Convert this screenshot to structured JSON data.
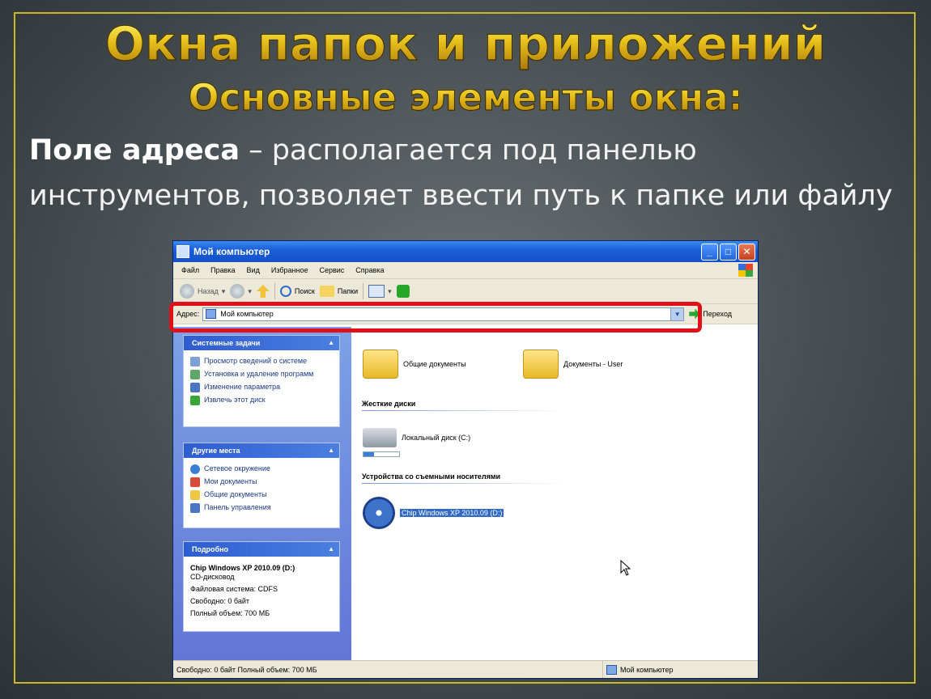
{
  "slide": {
    "title": "Окна папок и приложений",
    "subtitle": "Основные элементы окна:",
    "term": "Поле адреса",
    "dash": " – ",
    "line1_rest": "располагается под панелью",
    "line2": "инструментов, позволяет ввести путь к папке или файлу"
  },
  "window": {
    "title": "Мой компьютер",
    "menu": [
      "Файл",
      "Правка",
      "Вид",
      "Избранное",
      "Сервис",
      "Справка"
    ],
    "toolbar": {
      "back": "Назад",
      "search": "Поиск",
      "folders": "Папки"
    },
    "address": {
      "label": "Адрес:",
      "value": "Мой компьютер",
      "go": "Переход"
    },
    "system_tasks": {
      "title": "Системные задачи",
      "items": [
        "Просмотр сведений о системе",
        "Установка и удаление программ",
        "Изменение параметра",
        "Извлечь этот диск"
      ]
    },
    "other_places": {
      "title": "Другие места",
      "items": [
        "Сетевое окружение",
        "Мои документы",
        "Общие документы",
        "Панель управления"
      ]
    },
    "details": {
      "title": "Подробно",
      "name": "Chip Windows XP 2010.09 (D:)",
      "type": "CD-дисковод",
      "fs": "Файловая система: CDFS",
      "free": "Свободно: 0 байт",
      "total": "Полный объем: 700 МБ"
    },
    "content": {
      "folders": [
        "Общие документы",
        "Документы - User"
      ],
      "hard_disks_title": "Жесткие диски",
      "local_disk": "Локальный диск (C:)",
      "removable_title": "Устройства со съемными носителями",
      "cd_drive": "Chip Windows XP 2010.09 (D:)"
    },
    "status": {
      "left": "Свободно: 0 байт Полный объем: 700 МБ",
      "right": "Мой компьютер"
    }
  },
  "colors": {
    "frame": "#c9b72c",
    "highlight": "#e0101a",
    "xp_title": "#1b5fd9"
  }
}
